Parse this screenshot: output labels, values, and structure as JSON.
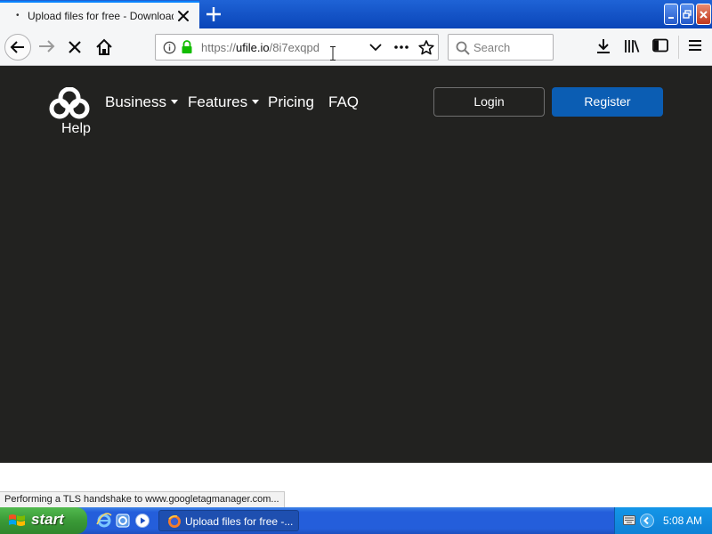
{
  "browser": {
    "tab": {
      "title": "Upload files for free - Download.zip",
      "loading_indicator": "•"
    },
    "url": {
      "scheme": "https://",
      "host": "ufile.io",
      "path": "/8i7exqpd"
    },
    "search_placeholder": "Search",
    "status_text": "Performing a TLS handshake to www.googletagmanager.com...",
    "accent_color": "#0a84ff"
  },
  "site": {
    "nav": {
      "business": "Business",
      "features": "Features",
      "pricing": "Pricing",
      "faq": "FAQ",
      "help": "Help"
    },
    "login_label": "Login",
    "register_label": "Register",
    "background_color": "#222220",
    "register_color": "#0b5db3"
  },
  "taskbar": {
    "start_label": "start",
    "active_task": "Upload files for free -...",
    "clock": "5:08 AM"
  }
}
